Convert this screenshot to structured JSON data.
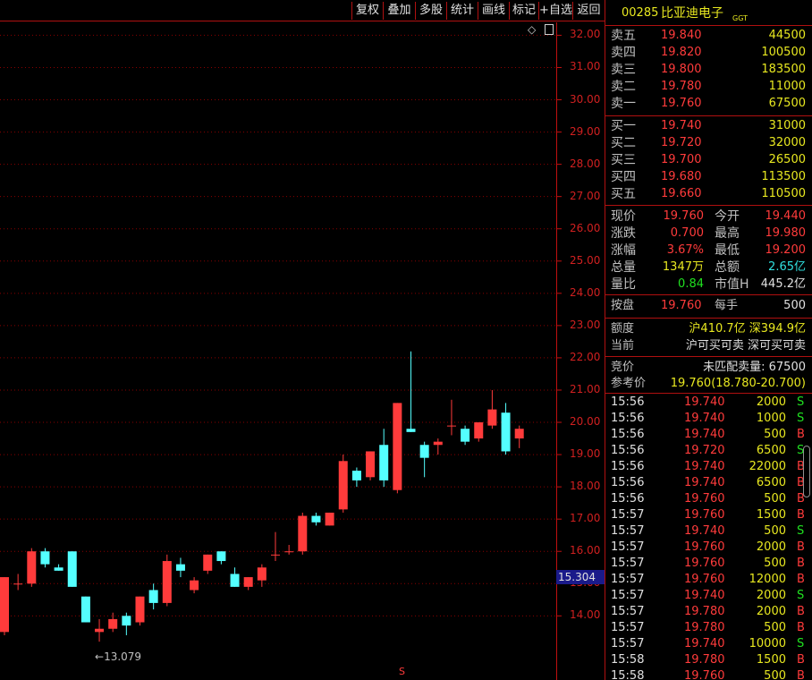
{
  "toolbar": {
    "buttons": [
      "复权",
      "叠加",
      "多股",
      "统计",
      "画线",
      "标记",
      "+自选",
      "返回"
    ]
  },
  "chart": {
    "y_ticks": [
      "32.00",
      "31.00",
      "30.00",
      "29.00",
      "28.00",
      "27.00",
      "26.00",
      "25.00",
      "24.00",
      "23.00",
      "22.00",
      "21.00",
      "20.00",
      "19.00",
      "18.00",
      "17.00",
      "16.00",
      "15.00",
      "14.00"
    ],
    "current_price_tag": "15.304",
    "low_marker": "13.079",
    "bottom_marker": "S",
    "colors": {
      "up": "#ff3b3b",
      "down": "#54ffff",
      "grid": "#8a0000",
      "axis": "#c01010"
    }
  },
  "chart_data": {
    "type": "candlestick",
    "ylim": [
      13.0,
      32.4
    ],
    "candles": [
      {
        "o": 13.5,
        "h": 15.2,
        "l": 13.4,
        "c": 15.2
      },
      {
        "o": 15.0,
        "h": 15.3,
        "l": 14.8,
        "c": 15.0
      },
      {
        "o": 15.0,
        "h": 16.1,
        "l": 14.9,
        "c": 16.0
      },
      {
        "o": 16.0,
        "h": 16.1,
        "l": 15.5,
        "c": 15.6
      },
      {
        "o": 15.5,
        "h": 15.6,
        "l": 15.4,
        "c": 15.4
      },
      {
        "o": 16.0,
        "h": 16.0,
        "l": 14.9,
        "c": 14.9
      },
      {
        "o": 14.6,
        "h": 14.6,
        "l": 13.8,
        "c": 13.8
      },
      {
        "o": 13.5,
        "h": 13.9,
        "l": 13.2,
        "c": 13.6
      },
      {
        "o": 13.6,
        "h": 14.1,
        "l": 13.5,
        "c": 13.9
      },
      {
        "o": 14.0,
        "h": 14.1,
        "l": 13.4,
        "c": 13.7
      },
      {
        "o": 13.8,
        "h": 14.6,
        "l": 13.7,
        "c": 14.6
      },
      {
        "o": 14.8,
        "h": 15.0,
        "l": 14.2,
        "c": 14.4
      },
      {
        "o": 14.4,
        "h": 15.9,
        "l": 14.3,
        "c": 15.7
      },
      {
        "o": 15.6,
        "h": 15.8,
        "l": 15.2,
        "c": 15.4
      },
      {
        "o": 14.8,
        "h": 15.2,
        "l": 14.7,
        "c": 15.1
      },
      {
        "o": 15.4,
        "h": 15.9,
        "l": 15.3,
        "c": 15.9
      },
      {
        "o": 16.0,
        "h": 16.0,
        "l": 15.6,
        "c": 15.7
      },
      {
        "o": 15.3,
        "h": 15.5,
        "l": 14.9,
        "c": 14.9
      },
      {
        "o": 14.9,
        "h": 15.2,
        "l": 14.8,
        "c": 15.2
      },
      {
        "o": 15.1,
        "h": 15.6,
        "l": 14.9,
        "c": 15.5
      },
      {
        "o": 15.9,
        "h": 16.6,
        "l": 15.7,
        "c": 15.9
      },
      {
        "o": 16.0,
        "h": 16.2,
        "l": 15.9,
        "c": 16.0
      },
      {
        "o": 16.0,
        "h": 17.2,
        "l": 15.9,
        "c": 17.1
      },
      {
        "o": 17.1,
        "h": 17.2,
        "l": 16.8,
        "c": 16.9
      },
      {
        "o": 16.8,
        "h": 17.2,
        "l": 16.8,
        "c": 17.2
      },
      {
        "o": 17.3,
        "h": 19.0,
        "l": 17.2,
        "c": 18.8
      },
      {
        "o": 18.5,
        "h": 18.6,
        "l": 18.0,
        "c": 18.2
      },
      {
        "o": 18.3,
        "h": 19.1,
        "l": 18.2,
        "c": 19.1
      },
      {
        "o": 19.3,
        "h": 19.8,
        "l": 18.0,
        "c": 18.2
      },
      {
        "o": 17.9,
        "h": 20.6,
        "l": 17.8,
        "c": 20.6
      },
      {
        "o": 19.8,
        "h": 22.2,
        "l": 19.7,
        "c": 19.7
      },
      {
        "o": 19.3,
        "h": 19.4,
        "l": 18.3,
        "c": 18.9
      },
      {
        "o": 19.3,
        "h": 19.5,
        "l": 19.0,
        "c": 19.4
      },
      {
        "o": 19.9,
        "h": 20.7,
        "l": 19.6,
        "c": 19.9
      },
      {
        "o": 19.8,
        "h": 19.9,
        "l": 19.3,
        "c": 19.4
      },
      {
        "o": 19.5,
        "h": 20.0,
        "l": 19.4,
        "c": 20.0
      },
      {
        "o": 19.9,
        "h": 21.0,
        "l": 19.8,
        "c": 20.4
      },
      {
        "o": 20.3,
        "h": 20.6,
        "l": 19.0,
        "c": 19.1
      },
      {
        "o": 19.5,
        "h": 19.9,
        "l": 19.2,
        "c": 19.8
      }
    ]
  },
  "stock": {
    "code": "00285",
    "name": "比亚迪电子",
    "tag": "GGT"
  },
  "asks": [
    {
      "label": "卖五",
      "price": "19.840",
      "vol": "44500"
    },
    {
      "label": "卖四",
      "price": "19.820",
      "vol": "100500"
    },
    {
      "label": "卖三",
      "price": "19.800",
      "vol": "183500"
    },
    {
      "label": "卖二",
      "price": "19.780",
      "vol": "11000"
    },
    {
      "label": "卖一",
      "price": "19.760",
      "vol": "67500"
    }
  ],
  "bids": [
    {
      "label": "买一",
      "price": "19.740",
      "vol": "31000"
    },
    {
      "label": "买二",
      "price": "19.720",
      "vol": "32000"
    },
    {
      "label": "买三",
      "price": "19.700",
      "vol": "26500"
    },
    {
      "label": "买四",
      "price": "19.680",
      "vol": "113500"
    },
    {
      "label": "买五",
      "price": "19.660",
      "vol": "110500"
    }
  ],
  "quote": {
    "rows": [
      {
        "l1": "现价",
        "v1": "19.760",
        "l2": "今开",
        "v2": "19.440"
      },
      {
        "l1": "涨跌",
        "v1": "0.700",
        "l2": "最高",
        "v2": "19.980"
      },
      {
        "l1": "涨幅",
        "v1": "3.67%",
        "l2": "最低",
        "v2": "19.200"
      },
      {
        "l1": "总量",
        "v1": "1347万",
        "l2": "总额",
        "v2": "2.65亿"
      },
      {
        "l1": "量比",
        "v1": "0.84",
        "l2": "市值H",
        "v2": "445.2亿"
      }
    ]
  },
  "closing": {
    "l1": "按盘",
    "v1": "19.760",
    "l2": "每手",
    "v2": "500"
  },
  "quota": {
    "label1": "额度",
    "value1": "沪410.7亿 深394.9亿",
    "label2": "当前",
    "value2": "沪可买可卖 深可买可卖"
  },
  "auction": {
    "label1": "竞价",
    "value1": "未匹配卖量: 67500",
    "label2": "参考价",
    "value2": "19.760(18.780-20.700)"
  },
  "ticks": [
    {
      "t": "15:56",
      "p": "19.740",
      "v": "2000",
      "s": "S"
    },
    {
      "t": "15:56",
      "p": "19.740",
      "v": "1000",
      "s": "S"
    },
    {
      "t": "15:56",
      "p": "19.740",
      "v": "500",
      "s": "B"
    },
    {
      "t": "15:56",
      "p": "19.720",
      "v": "6500",
      "s": "S"
    },
    {
      "t": "15:56",
      "p": "19.740",
      "v": "22000",
      "s": "B"
    },
    {
      "t": "15:56",
      "p": "19.740",
      "v": "6500",
      "s": "B"
    },
    {
      "t": "15:56",
      "p": "19.760",
      "v": "500",
      "s": "B"
    },
    {
      "t": "15:57",
      "p": "19.760",
      "v": "1500",
      "s": "B"
    },
    {
      "t": "15:57",
      "p": "19.740",
      "v": "500",
      "s": "S"
    },
    {
      "t": "15:57",
      "p": "19.760",
      "v": "2000",
      "s": "B"
    },
    {
      "t": "15:57",
      "p": "19.760",
      "v": "500",
      "s": "B"
    },
    {
      "t": "15:57",
      "p": "19.760",
      "v": "12000",
      "s": "B"
    },
    {
      "t": "15:57",
      "p": "19.740",
      "v": "2000",
      "s": "S"
    },
    {
      "t": "15:57",
      "p": "19.780",
      "v": "2000",
      "s": "B"
    },
    {
      "t": "15:57",
      "p": "19.780",
      "v": "500",
      "s": "B"
    },
    {
      "t": "15:57",
      "p": "19.740",
      "v": "10000",
      "s": "S"
    },
    {
      "t": "15:58",
      "p": "19.780",
      "v": "1500",
      "s": "B"
    },
    {
      "t": "15:58",
      "p": "19.760",
      "v": "500",
      "s": "B"
    }
  ]
}
